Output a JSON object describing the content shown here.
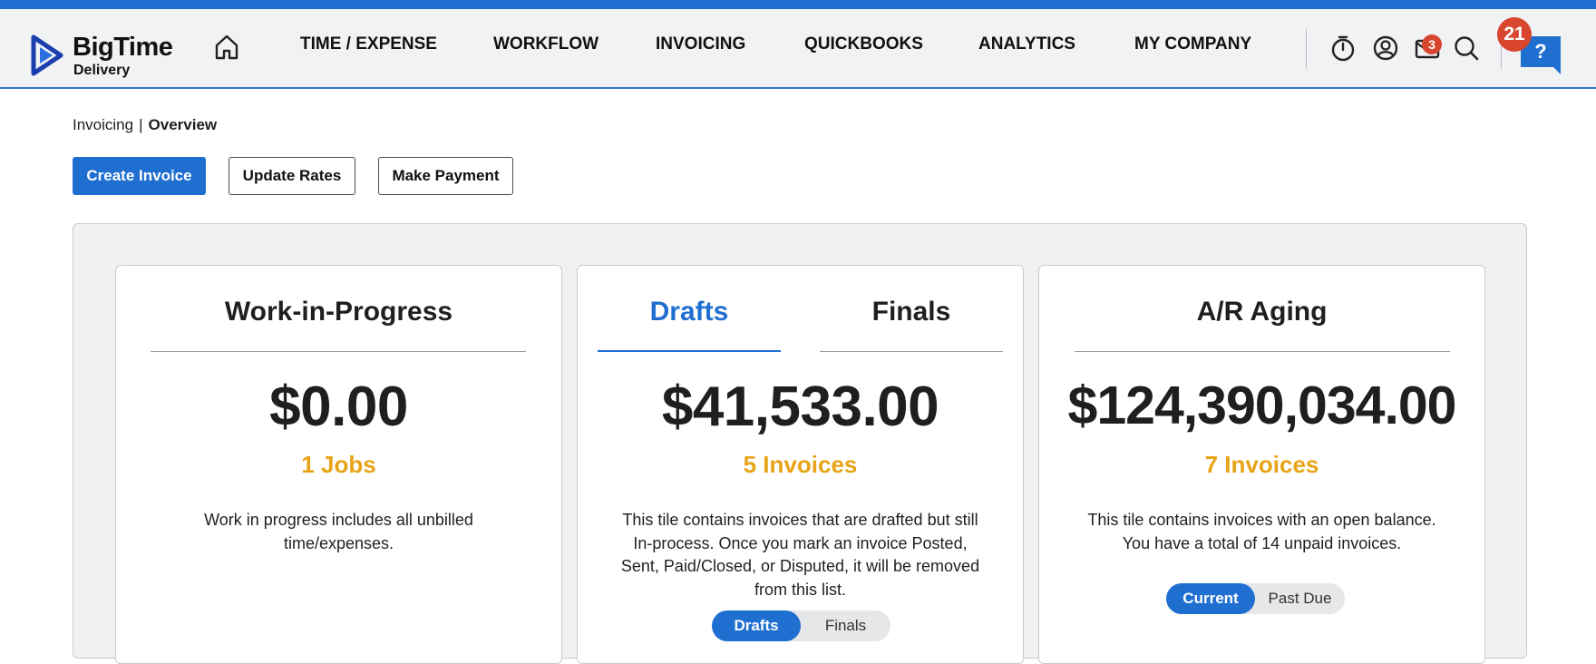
{
  "app": {
    "logo_name": "BigTime",
    "logo_sub": "Delivery",
    "accent_color": "#1f6fd1",
    "badge_color": "#d9462f",
    "count_color": "#e8a417"
  },
  "nav": {
    "items": [
      "TIME / EXPENSE",
      "WORKFLOW",
      "INVOICING",
      "QUICKBOOKS",
      "ANALYTICS",
      "MY COMPANY"
    ],
    "icons": [
      "home-icon",
      "timer-icon",
      "profile-icon",
      "mail-icon",
      "search-icon",
      "help-icon"
    ],
    "mail_badge": "3",
    "help_badge": "21",
    "help_label": "?"
  },
  "breadcrumb": {
    "parent": "Invoicing",
    "separator": "|",
    "current": "Overview"
  },
  "actions": {
    "create_invoice": "Create Invoice",
    "update_rates": "Update Rates",
    "make_payment": "Make Payment"
  },
  "tiles": {
    "wip": {
      "title": "Work-in-Progress",
      "amount": "$0.00",
      "count": "1 Jobs",
      "description_lines": [
        "Work in progress includes all unbilled",
        "time/expenses."
      ]
    },
    "drafts": {
      "tab_active": "Drafts",
      "tab_inactive": "Finals",
      "amount": "$41,533.00",
      "count": "5 Invoices",
      "description_lines": [
        "This tile contains invoices that are drafted but still",
        "In-process. Once you mark an invoice Posted,",
        "Sent, Paid/Closed, or Disputed, it will be removed",
        "from this list."
      ],
      "toggle_active": "Drafts",
      "toggle_inactive": "Finals"
    },
    "ar": {
      "title": "A/R Aging",
      "amount": "$124,390,034.00",
      "count": "7 Invoices",
      "description_lines": [
        "This tile contains invoices with an open balance.",
        "You have a total of 14 unpaid invoices."
      ],
      "toggle_active": "Current",
      "toggle_inactive": "Past Due"
    }
  }
}
